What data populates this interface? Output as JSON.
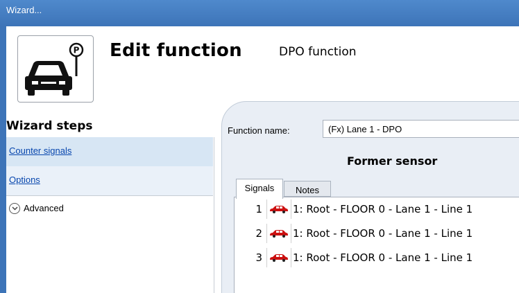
{
  "window": {
    "title": "Wizard..."
  },
  "header": {
    "title": "Edit function",
    "subtitle": "DPO function",
    "icon": "parking-car-icon"
  },
  "sidebar": {
    "heading": "Wizard steps",
    "items": [
      {
        "label": "Counter signals"
      },
      {
        "label": "Options"
      }
    ],
    "advanced": {
      "label": "Advanced",
      "icon": "chevron-down-circle-icon"
    }
  },
  "main": {
    "function_name_label": "Function name:",
    "function_name_value": "(Fx) Lane 1 - DPO",
    "section_title": "Former sensor",
    "tabs": [
      {
        "label": "Signals"
      },
      {
        "label": "Notes"
      }
    ],
    "signals": [
      {
        "index": "1",
        "icon": "car-icon",
        "text": "1: Root - FLOOR 0 - Lane 1 - Line 1"
      },
      {
        "index": "2",
        "icon": "car-icon",
        "text": "1: Root - FLOOR 0 - Lane 1 - Line 1"
      },
      {
        "index": "3",
        "icon": "car-icon",
        "text": "1: Root - FLOOR 0 - Lane 1 - Line 1"
      }
    ]
  },
  "colors": {
    "titlebar": "#3d74b8",
    "link": "#0645ad",
    "selected": "#d7e6f4",
    "car": "#cc1111"
  }
}
